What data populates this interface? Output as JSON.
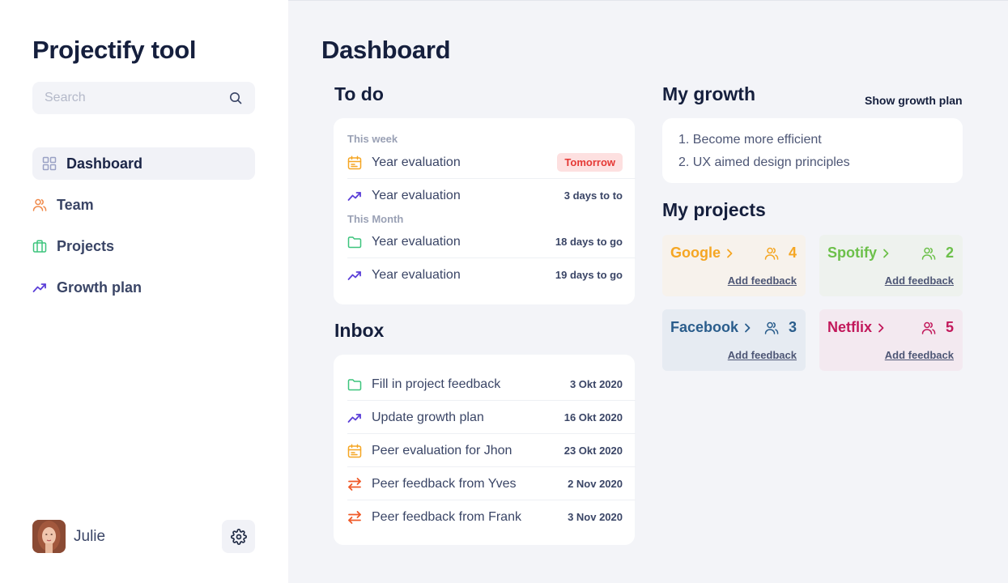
{
  "sidebar": {
    "app_title": "Projectify tool",
    "search_placeholder": "Search",
    "items": [
      {
        "label": "Dashboard",
        "icon": "grid-icon",
        "active": true
      },
      {
        "label": "Team",
        "icon": "users-icon"
      },
      {
        "label": "Projects",
        "icon": "briefcase-icon"
      },
      {
        "label": "Growth plan",
        "icon": "trending-up-icon"
      }
    ],
    "user_name": "Julie"
  },
  "main": {
    "title": "Dashboard",
    "todo": {
      "title": "To do",
      "groups": [
        {
          "label": "This week",
          "items": [
            {
              "text": "Year evaluation",
              "meta": "Tomorrow",
              "icon": "calendar-icon",
              "badge": true
            },
            {
              "text": "Year evaluation",
              "meta": "3 days to to",
              "icon": "trending-up-icon"
            }
          ]
        },
        {
          "label": "This Month",
          "items": [
            {
              "text": "Year evaluation",
              "meta": "18 days to go",
              "icon": "folder-icon"
            },
            {
              "text": "Year evaluation",
              "meta": "19 days to go",
              "icon": "trending-up-icon"
            }
          ]
        }
      ]
    },
    "inbox": {
      "title": "Inbox",
      "items": [
        {
          "text": "Fill in project feedback",
          "date": "3 Okt 2020",
          "icon": "folder-icon"
        },
        {
          "text": "Update growth plan",
          "date": "16 Okt 2020",
          "icon": "trending-up-icon"
        },
        {
          "text": "Peer evaluation for Jhon",
          "date": "23 Okt 2020",
          "icon": "calendar-icon"
        },
        {
          "text": "Peer feedback from Yves",
          "date": "2 Nov 2020",
          "icon": "swap-icon"
        },
        {
          "text": "Peer feedback from Frank",
          "date": "3 Nov 2020",
          "icon": "swap-icon"
        }
      ]
    },
    "growth": {
      "title": "My growth",
      "link": "Show growth plan",
      "items": [
        "1. Become more efficient",
        "2. UX aimed design principles"
      ]
    },
    "projects": {
      "title": "My projects",
      "items": [
        {
          "name": "Google",
          "count": "4",
          "feedback": "Add feedback",
          "color": "#f5a623",
          "bg": "#f7f2ec"
        },
        {
          "name": "Spotify",
          "count": "2",
          "feedback": "Add feedback",
          "color": "#6cc04a",
          "bg": "#eef2ee"
        },
        {
          "name": "Facebook",
          "count": "3",
          "feedback": "Add feedback",
          "color": "#2a5d8c",
          "bg": "#e6ebf2"
        },
        {
          "name": "Netflix",
          "count": "5",
          "feedback": "Add feedback",
          "color": "#c2185b",
          "bg": "#f3e9f0"
        }
      ]
    }
  },
  "colors": {
    "accent_purple": "#5b3fd8",
    "accent_orange": "#f5a623",
    "accent_green": "#3cc47c",
    "accent_red": "#e53935"
  }
}
